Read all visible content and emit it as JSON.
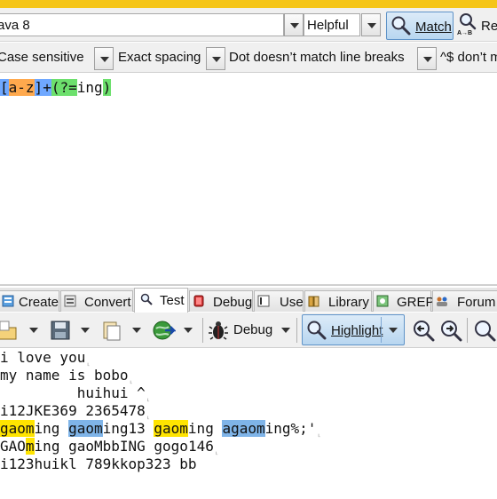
{
  "toolbar": {
    "flavor_value": "ava 8",
    "mode_value": "Helpful",
    "match_label": "Match",
    "replace_label": "Re",
    "replace_icon_text": "A→B"
  },
  "options": {
    "case": "Case sensitive",
    "spacing": "Exact spacing",
    "dot": "Dot doesn’t match line breaks",
    "anchors": "^$ don’t m"
  },
  "regex": {
    "tokens": [
      {
        "text": "[",
        "kind": "bracket"
      },
      {
        "text": "a-z",
        "kind": "class"
      },
      {
        "text": "]",
        "kind": "bracket"
      },
      {
        "text": "+",
        "kind": "op"
      },
      {
        "text": "(?=",
        "kind": "group"
      },
      {
        "text": "ing",
        "kind": "plain"
      },
      {
        "text": ")",
        "kind": "group"
      }
    ]
  },
  "tabs": [
    {
      "label": "Create"
    },
    {
      "label": "Convert"
    },
    {
      "label": "Test"
    },
    {
      "label": "Debug"
    },
    {
      "label": "Use"
    },
    {
      "label": "Library"
    },
    {
      "label": "GREP"
    },
    {
      "label": "Forum"
    }
  ],
  "test_toolbar": {
    "debug_label": "Debug",
    "highlight_label": "Highlight"
  },
  "test_lines": [
    [
      {
        "text": "i love you"
      }
    ],
    [
      {
        "text": "my name is bobo"
      }
    ],
    [
      {
        "text": "         huihui ^"
      }
    ],
    [
      {
        "text": "i12JKE369 2365478"
      }
    ],
    [
      {
        "text": "gaom",
        "hl": "y"
      },
      {
        "text": "ing "
      },
      {
        "text": "gaom",
        "hl": "b"
      },
      {
        "text": "ing13 "
      },
      {
        "text": "gaom",
        "hl": "y"
      },
      {
        "text": "ing "
      },
      {
        "text": "agaom",
        "hl": "b"
      },
      {
        "text": "ing%;'"
      }
    ],
    [
      {
        "text": "GAO"
      },
      {
        "text": "m",
        "hl": "y"
      },
      {
        "text": "ing gaoMbbING gogo146"
      }
    ],
    [
      {
        "text": "i123huikl 789kkop323 bb",
        "nomark": true
      }
    ]
  ],
  "colors": {
    "accent": "#f5c518",
    "highlight_yellow": "#ffe400",
    "highlight_blue": "#7fb4e8",
    "regex_class": "#ffa94d",
    "regex_bracket": "#6fa8ff",
    "regex_group": "#6de06d"
  }
}
